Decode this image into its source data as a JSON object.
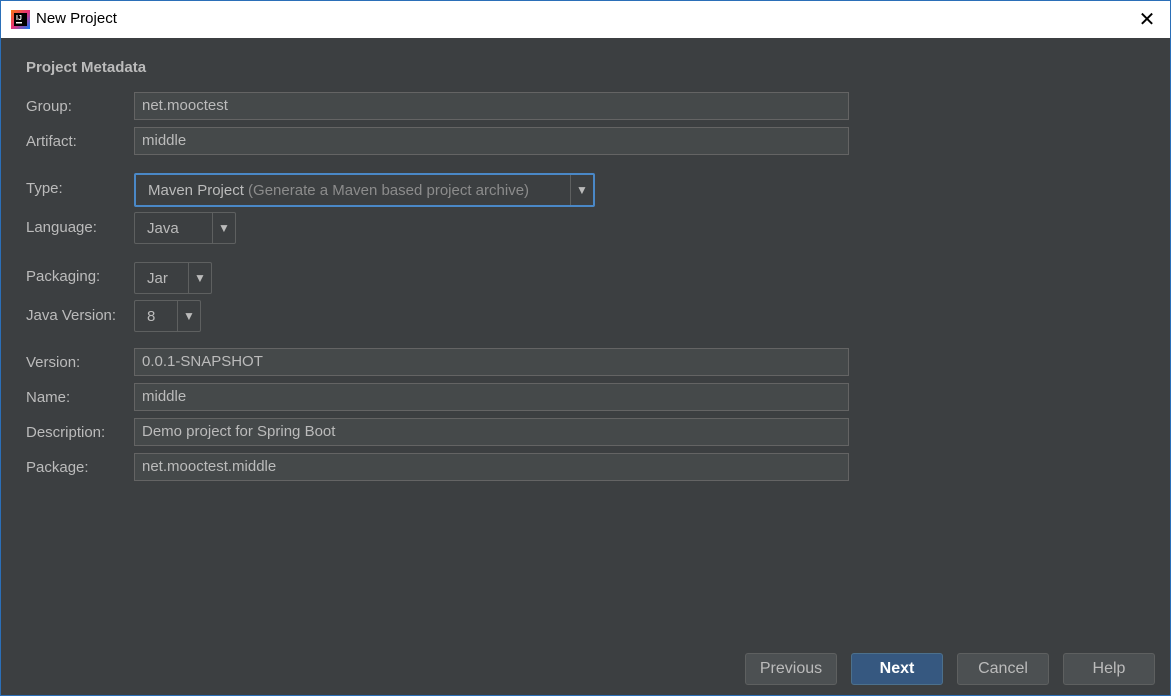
{
  "window": {
    "title": "New Project"
  },
  "section_title": "Project Metadata",
  "fields": {
    "group": {
      "label": "Group:",
      "value": "net.mooctest"
    },
    "artifact": {
      "label": "Artifact:",
      "value": "middle"
    },
    "version": {
      "label": "Version:",
      "value": "0.0.1-SNAPSHOT"
    },
    "name": {
      "label": "Name:",
      "value": "middle"
    },
    "description": {
      "label": "Description:",
      "value": "Demo project for Spring Boot"
    },
    "package": {
      "label": "Package:",
      "value": "net.mooctest.middle"
    }
  },
  "combos": {
    "type": {
      "label": "Type:",
      "value": "Maven Project",
      "hint": "(Generate a Maven based project archive)"
    },
    "language": {
      "label": "Language:",
      "value": "Java"
    },
    "packaging": {
      "label": "Packaging:",
      "value": "Jar"
    },
    "java_version": {
      "label": "Java Version:",
      "value": "8"
    }
  },
  "buttons": {
    "previous": "Previous",
    "next": "Next",
    "cancel": "Cancel",
    "help": "Help"
  },
  "icons": {
    "app": "intellij-idea-icon",
    "close": "close-icon",
    "dropdown": "triangle-down-icon"
  }
}
